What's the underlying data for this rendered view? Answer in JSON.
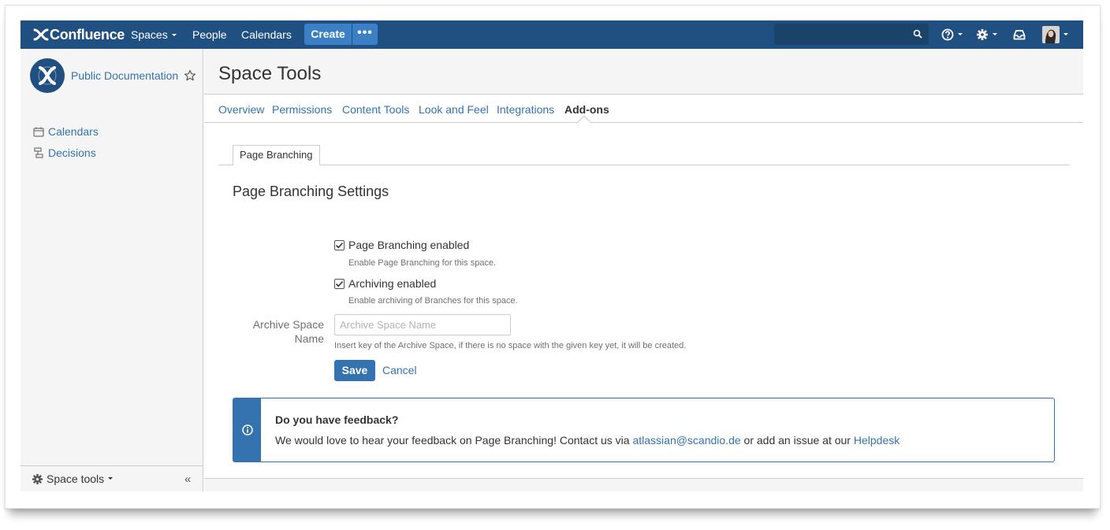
{
  "topbar": {
    "logo_text": "Confluence",
    "nav": [
      "Spaces",
      "People",
      "Calendars"
    ],
    "create_label": "Create",
    "more_label": "•••",
    "search_placeholder": "",
    "colors": {
      "bar": "#205081",
      "button": "#3b7fc4"
    },
    "icons": [
      "help-icon",
      "settings-icon",
      "notifications-icon",
      "user-avatar"
    ]
  },
  "sidebar": {
    "space_name": "Public Documentation",
    "links": [
      {
        "label": "Calendars",
        "icon": "calendar-icon"
      },
      {
        "label": "Decisions",
        "icon": "decisions-icon"
      }
    ],
    "footer_label": "Space tools",
    "collapse_glyph": "«"
  },
  "main": {
    "title": "Space Tools",
    "tabs": [
      "Overview",
      "Permissions",
      "Content Tools",
      "Look and Feel",
      "Integrations",
      "Add-ons"
    ],
    "active_tab": "Add-ons",
    "subtab": "Page Branching",
    "section_title": "Page Branching Settings",
    "options": [
      {
        "label": "Page Branching enabled",
        "help": "Enable Page Branching for this space.",
        "checked": true
      },
      {
        "label": "Archiving enabled",
        "help": "Enable archiving of Branches for this space.",
        "checked": true
      }
    ],
    "archive_field": {
      "label": "Archive Space Name",
      "placeholder": "Archive Space Name",
      "value": "",
      "help": "Insert key of the Archive Space, if there is no space with the given key yet, it will be created."
    },
    "save_label": "Save",
    "cancel_label": "Cancel"
  },
  "feedback": {
    "title": "Do you have feedback?",
    "text_before": "We would love to hear your feedback on Page Branching! Contact us via ",
    "email": "atlassian@scandio.de",
    "text_middle": " or add an issue at our ",
    "helpdesk": "Helpdesk"
  }
}
